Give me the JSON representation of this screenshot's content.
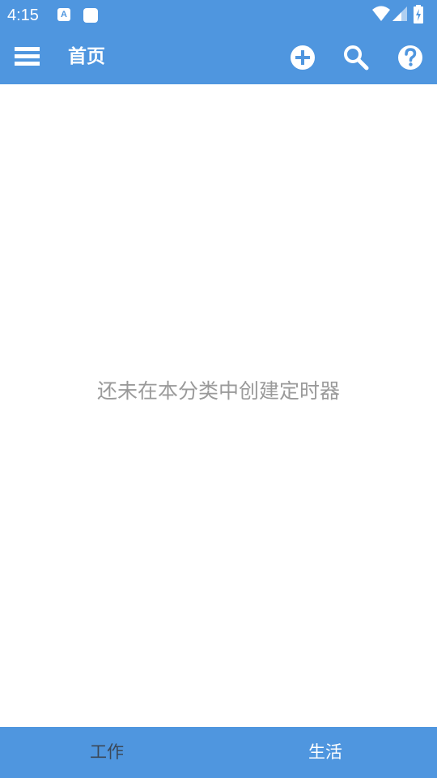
{
  "status_bar": {
    "time": "4:15",
    "a_icon_text": "A",
    "icons": [
      "text-a-icon",
      "square-notification-icon",
      "wifi-icon",
      "signal-icon",
      "battery-charging-icon"
    ]
  },
  "toolbar": {
    "title": "首页",
    "icons": [
      "menu-icon",
      "add-circle-icon",
      "search-icon",
      "help-circle-icon"
    ]
  },
  "main": {
    "empty_message": "还未在本分类中创建定时器"
  },
  "bottom_tabs": [
    {
      "label": "工作",
      "selected": false
    },
    {
      "label": "生活",
      "selected": true
    }
  ],
  "colors": {
    "primary": "#4f96df",
    "empty_text": "#9a9a9a",
    "inactive_tab": "#3b4858",
    "active_tab": "#ffffff"
  }
}
